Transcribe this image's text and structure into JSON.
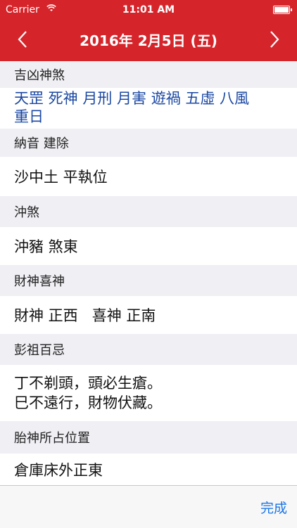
{
  "status_bar": {
    "carrier": "Carrier",
    "time": "11:01 AM"
  },
  "nav": {
    "title": "2016年 2月5日 (五)"
  },
  "sections": [
    {
      "header": "吉凶神煞",
      "body_lines": [
        "天罡 死神 月刑 月害 遊禍 五虛 八風",
        "重日"
      ]
    },
    {
      "header": "納音 建除",
      "body_lines": [
        "沙中土 平執位"
      ]
    },
    {
      "header": "沖煞",
      "body_lines": [
        "沖豬 煞東"
      ]
    },
    {
      "header": "財神喜神",
      "body_lines": [
        "財神 正西   喜神 正南"
      ]
    },
    {
      "header": "彭祖百忌",
      "body_lines": [
        "丁不剃頭，頭必生瘡。",
        "巳不遠行，財物伏藏。"
      ]
    },
    {
      "header": "胎神所占位置",
      "body_lines": [
        "倉庫床外正東"
      ]
    }
  ],
  "toolbar": {
    "done_label": "完成"
  },
  "colors": {
    "header_red": "#d5252b",
    "shensha_blue": "#1a47a3",
    "done_blue": "#1a75e6",
    "section_gray": "#efeff4"
  }
}
